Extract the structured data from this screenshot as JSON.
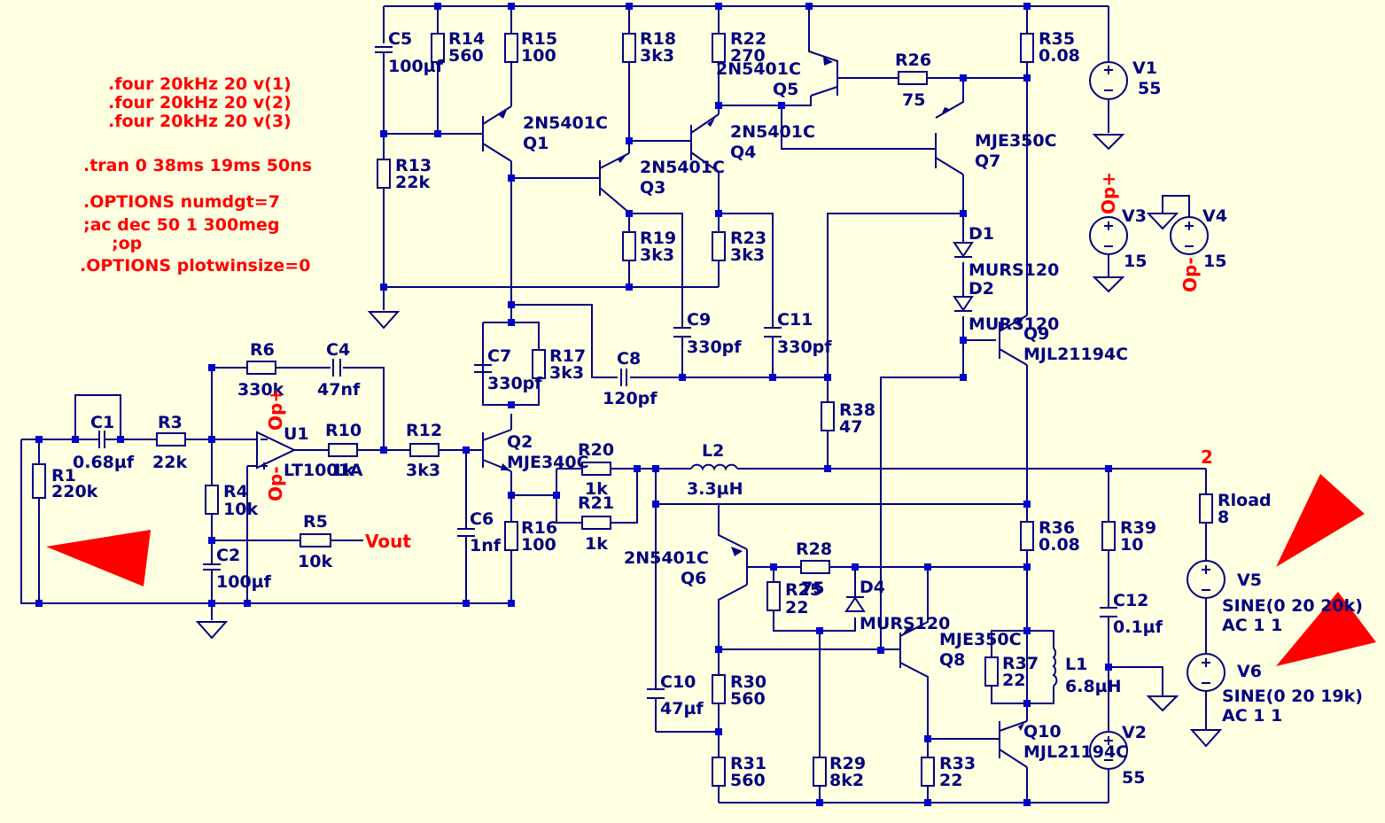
{
  "directives": [
    ".four 20kHz 20 v(1)",
    ".four 20kHz 20 v(2)",
    ".four 20kHz 20 v(3)",
    ".tran 0 38ms 19ms 50ns",
    ".OPTIONS numdgt=7",
    ";ac dec 50 1 300meg",
    ";op",
    ".OPTIONS plotwinsize=0"
  ],
  "colors": {
    "background": "#FFFFE1",
    "wire": "#000080",
    "directive": "#FF0000",
    "net_label": "#FF0000"
  },
  "components": [
    {
      "ref": "R1",
      "value": "220k"
    },
    {
      "ref": "C1",
      "value": "0.68µf"
    },
    {
      "ref": "R3",
      "value": "22k"
    },
    {
      "ref": "R4",
      "value": "10k"
    },
    {
      "ref": "C2",
      "value": "100µf"
    },
    {
      "ref": "R6",
      "value": "330k"
    },
    {
      "ref": "C4",
      "value": "47nf"
    },
    {
      "ref": "U1",
      "value": "LT1001A"
    },
    {
      "ref": "R10",
      "value": "1k"
    },
    {
      "ref": "R5",
      "value": "10k"
    },
    {
      "ref": "R12",
      "value": "3k3"
    },
    {
      "ref": "C6",
      "value": "1nf"
    },
    {
      "ref": "C5",
      "value": "100µf"
    },
    {
      "ref": "R14",
      "value": "560"
    },
    {
      "ref": "R15",
      "value": "100"
    },
    {
      "ref": "R13",
      "value": "22k"
    },
    {
      "ref": "Q1",
      "value": "2N5401C"
    },
    {
      "ref": "R18",
      "value": "3k3"
    },
    {
      "ref": "R22",
      "value": "270"
    },
    {
      "ref": "Q4",
      "value": "2N5401C"
    },
    {
      "ref": "Q3",
      "value": "2N5401C"
    },
    {
      "ref": "R19",
      "value": "3k3"
    },
    {
      "ref": "R23",
      "value": "3k3"
    },
    {
      "ref": "Q5",
      "value": "2N5401C"
    },
    {
      "ref": "R26",
      "value": "75"
    },
    {
      "ref": "Q7",
      "value": "MJE350C"
    },
    {
      "ref": "R35",
      "value": "0.08"
    },
    {
      "ref": "V1",
      "value": "55"
    },
    {
      "ref": "V3",
      "value": "15"
    },
    {
      "ref": "V4",
      "value": "15"
    },
    {
      "ref": "C7",
      "value": "330pf"
    },
    {
      "ref": "R17",
      "value": "3k3"
    },
    {
      "ref": "C8",
      "value": "120pf"
    },
    {
      "ref": "C9",
      "value": "330pf"
    },
    {
      "ref": "C11",
      "value": "330pf"
    },
    {
      "ref": "D1",
      "value": "MURS120"
    },
    {
      "ref": "D2",
      "value": "MURS120"
    },
    {
      "ref": "Q9",
      "value": "MJL21194C"
    },
    {
      "ref": "R38",
      "value": "47"
    },
    {
      "ref": "Q2",
      "value": "MJE340C"
    },
    {
      "ref": "R20",
      "value": "1k"
    },
    {
      "ref": "R21",
      "value": "1k"
    },
    {
      "ref": "R16",
      "value": "100"
    },
    {
      "ref": "L2",
      "value": "3.3µH"
    },
    {
      "ref": "Q6",
      "value": "2N5401C"
    },
    {
      "ref": "R28",
      "value": "75"
    },
    {
      "ref": "R25",
      "value": "22"
    },
    {
      "ref": "D4",
      "value": "MURS120"
    },
    {
      "ref": "Q8",
      "value": "MJE350C"
    },
    {
      "ref": "R36",
      "value": "0.08"
    },
    {
      "ref": "R39",
      "value": "10"
    },
    {
      "ref": "C12",
      "value": "0.1µf"
    },
    {
      "ref": "Rload",
      "value": "8"
    },
    {
      "ref": "V5",
      "value": "SINE(0 20 20k)",
      "value2": "AC 1 1"
    },
    {
      "ref": "V6",
      "value": "SINE(0 20 19k)",
      "value2": "AC 1 1"
    },
    {
      "ref": "C10",
      "value": "47µf"
    },
    {
      "ref": "R30",
      "value": "560"
    },
    {
      "ref": "R31",
      "value": "560"
    },
    {
      "ref": "R29",
      "value": "8k2"
    },
    {
      "ref": "R37",
      "value": "22"
    },
    {
      "ref": "L1",
      "value": "6.8µH"
    },
    {
      "ref": "Q10",
      "value": "MJL21194C"
    },
    {
      "ref": "R33",
      "value": "22"
    },
    {
      "ref": "V2",
      "value": "55"
    }
  ],
  "net_labels": [
    "Vout",
    "2",
    "Op+",
    "Op-"
  ]
}
